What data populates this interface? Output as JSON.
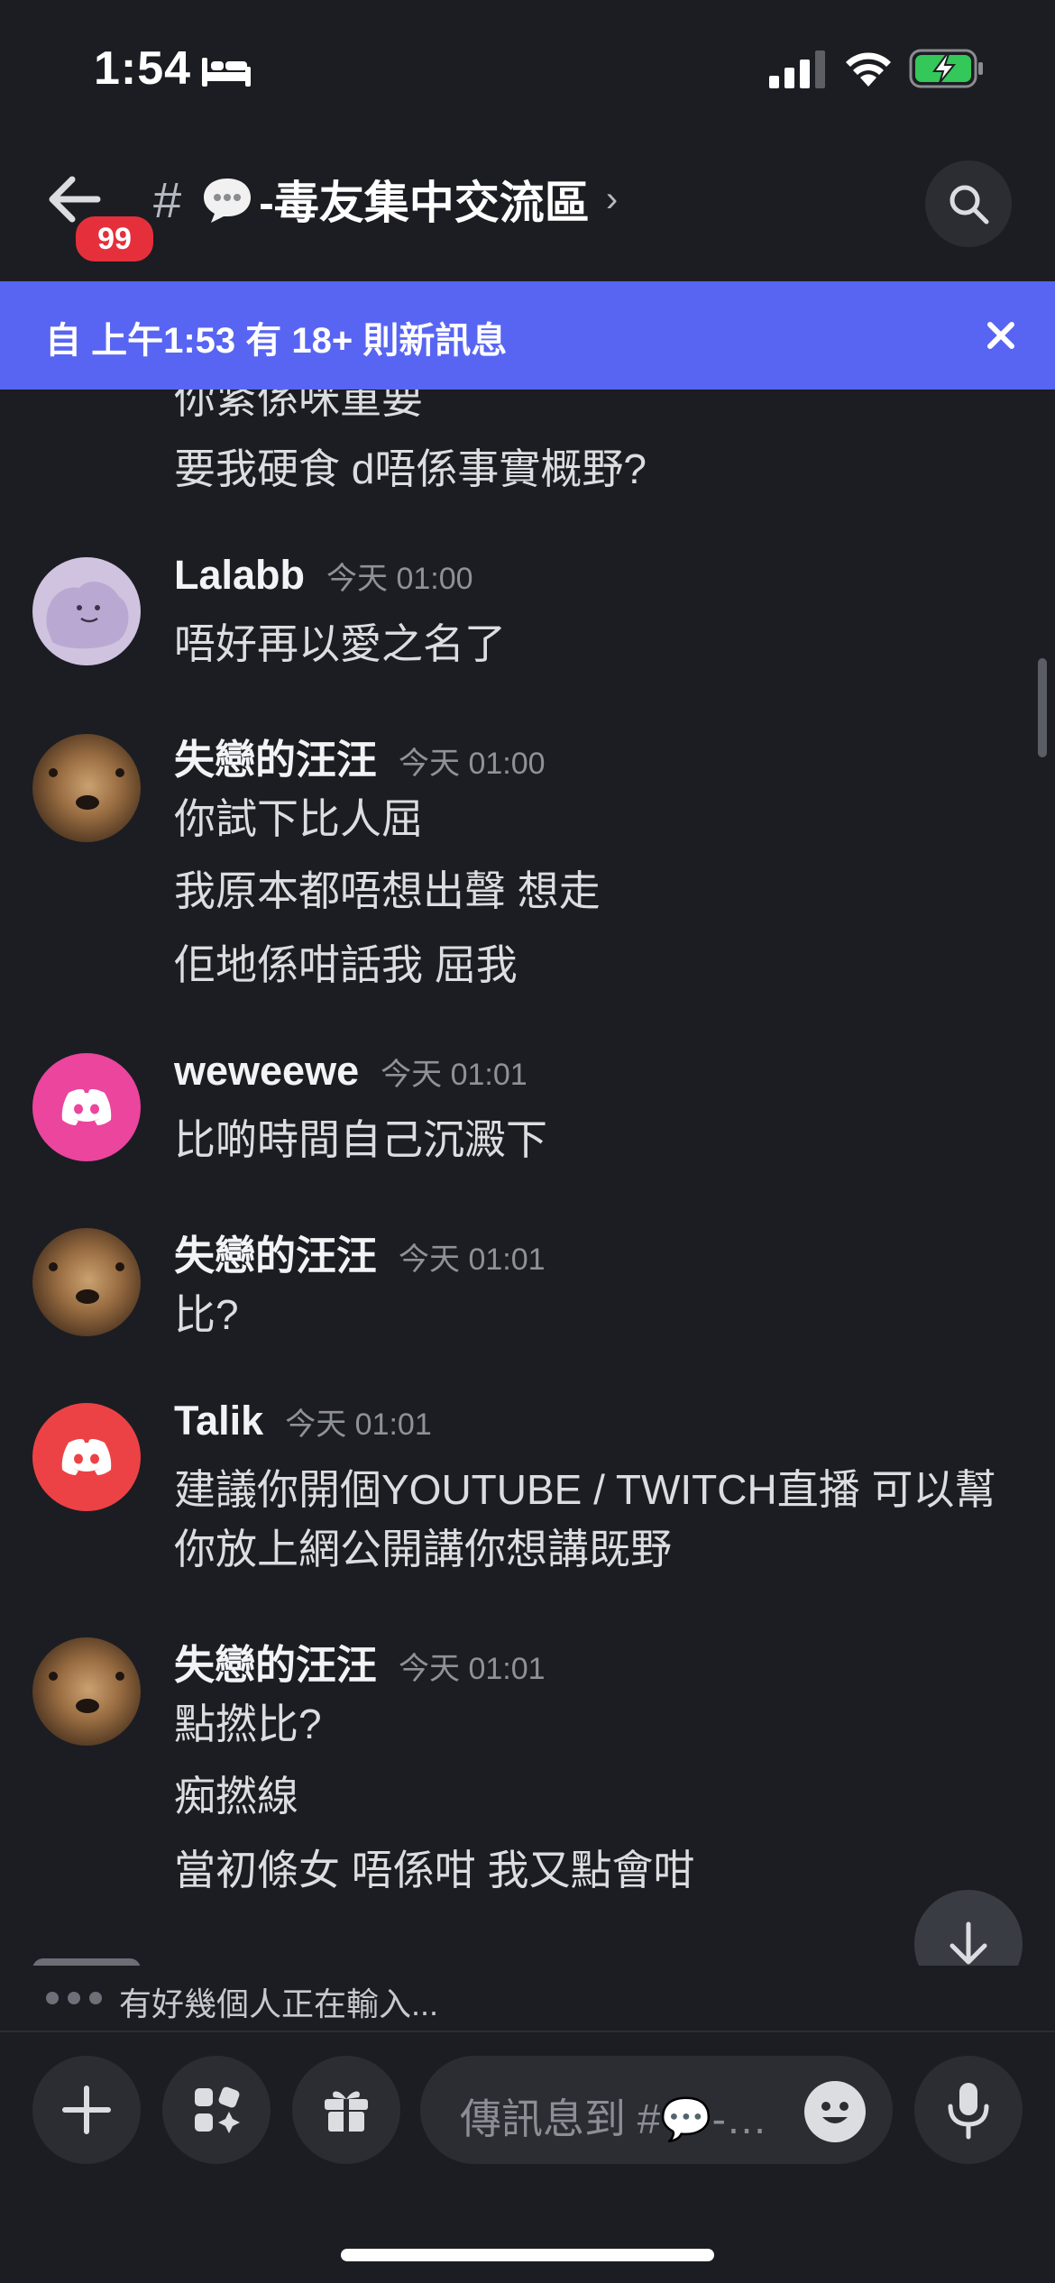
{
  "status": {
    "time": "1:54"
  },
  "header": {
    "badge": "99",
    "hash": "#",
    "channel": "-毒友集中交流區",
    "chevron": "›"
  },
  "banner": {
    "text": "自 上午1:53 有 18+ 則新訊息"
  },
  "messages": {
    "partial_line": "你紧係咪重要",
    "m0_line": "要我硬食 d唔係事實概野?",
    "m1": {
      "user": "Lalabb",
      "time": "今天 01:00",
      "lines": [
        "唔好再以愛之名了"
      ]
    },
    "m2": {
      "user": "失戀的汪汪",
      "time": "今天 01:00",
      "lines": [
        "你試下比人屈",
        "我原本都唔想出聲 想走",
        "佢地係咁話我 屈我"
      ]
    },
    "m3": {
      "user": "weweewe",
      "time": "今天 01:01",
      "lines": [
        "比啲時間自己沉澱下"
      ]
    },
    "m4": {
      "user": "失戀的汪汪",
      "time": "今天 01:01",
      "lines": [
        "比?"
      ]
    },
    "m5": {
      "user": "Talik",
      "time": "今天 01:01",
      "lines": [
        "建議你開個YOUTUBE / TWITCH直播 可以幫",
        "你放上網公開講你想講既野"
      ]
    },
    "m6": {
      "user": "失戀的汪汪",
      "time": "今天 01:01",
      "lines": [
        "點撚比?",
        "痴撚線",
        "當初條女 唔係咁 我又點會咁"
      ]
    }
  },
  "typing": {
    "text": "有好幾個人正在輸入..."
  },
  "composer": {
    "placeholder": "傳訊息到 #💬-…"
  },
  "colors": {
    "background": "#1c1d22",
    "banner": "#5865f2",
    "badge": "#e5303c",
    "discord_pink": "#eb459e",
    "discord_red": "#ed4245",
    "battery_green": "#34c759"
  },
  "icons": [
    "bed-icon",
    "signal-icon",
    "wifi-icon",
    "battery-icon",
    "back-arrow-icon",
    "speech-bubble-icon",
    "search-icon",
    "close-icon",
    "discord-icon",
    "arrow-down-icon",
    "plus-icon",
    "apps-icon",
    "gift-icon",
    "emoji-icon",
    "microphone-icon"
  ]
}
